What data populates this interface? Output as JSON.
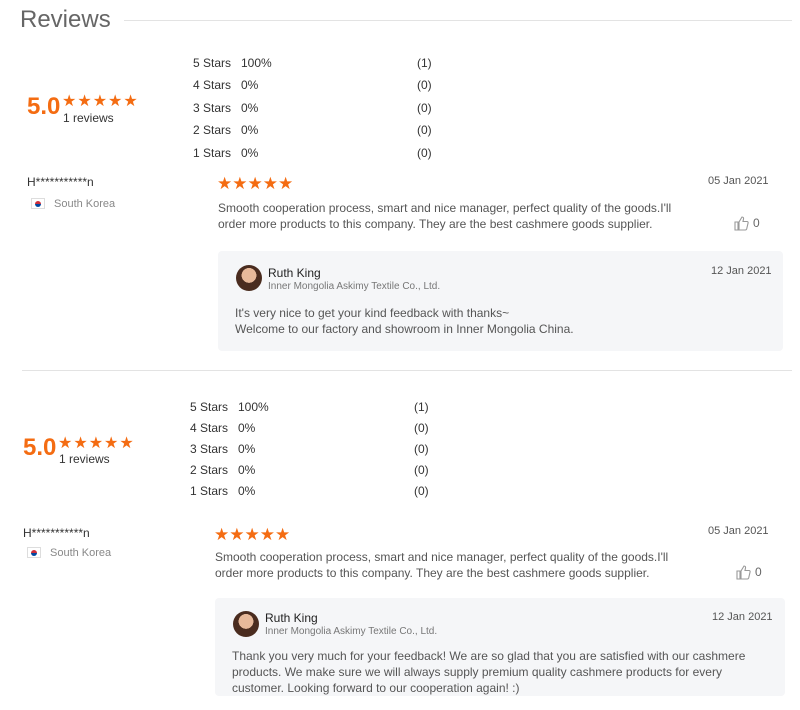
{
  "header": {
    "title": "Reviews"
  },
  "sections": [
    {
      "summary": {
        "score": "5.0",
        "stars": "★★★★★",
        "count_text": "1 reviews"
      },
      "distribution": [
        {
          "label": "5  Stars",
          "percent": "100%",
          "count": "(1)"
        },
        {
          "label": "4  Stars",
          "percent": "0%",
          "count": "(0)"
        },
        {
          "label": "3  Stars",
          "percent": "0%",
          "count": "(0)"
        },
        {
          "label": "2  Stars",
          "percent": "0%",
          "count": "(0)"
        },
        {
          "label": "1  Stars",
          "percent": "0%",
          "count": "(0)"
        }
      ],
      "review": {
        "reviewer": "H***********n",
        "country": "South Korea",
        "stars": "★★★★★",
        "rating": 5,
        "date": "05 Jan 2021",
        "text": "Smooth cooperation process, smart and nice manager, perfect quality of the goods.I'll order more products to this company. They are the best cashmere goods supplier.",
        "likes": "0",
        "reply": {
          "name": "Ruth King",
          "company": "Inner Mongolia Askimy Textile Co., Ltd.",
          "date": "12 Jan 2021",
          "text": "It's very nice to get your kind feedback with thanks~\nWelcome to our factory and showroom in Inner Mongolia China."
        }
      }
    },
    {
      "summary": {
        "score": "5.0",
        "stars": "★★★★★",
        "count_text": "1 reviews"
      },
      "distribution": [
        {
          "label": "5  Stars",
          "percent": "100%",
          "count": "(1)"
        },
        {
          "label": "4  Stars",
          "percent": "0%",
          "count": "(0)"
        },
        {
          "label": "3  Stars",
          "percent": "0%",
          "count": "(0)"
        },
        {
          "label": "2  Stars",
          "percent": "0%",
          "count": "(0)"
        },
        {
          "label": "1  Stars",
          "percent": "0%",
          "count": "(0)"
        }
      ],
      "review": {
        "reviewer": "H***********n",
        "country": "South Korea",
        "stars": "★★★★★",
        "rating": 5,
        "date": "05 Jan 2021",
        "text": "Smooth cooperation process, smart and nice manager, perfect quality of the goods.I'll order more products to this company. They are the best cashmere goods supplier.",
        "likes": "0",
        "reply": {
          "name": "Ruth King",
          "company": "Inner Mongolia Askimy Textile Co., Ltd.",
          "date": "12 Jan 2021",
          "text": "Thank you very much for your feedback! We are so glad that you are satisfied with our cashmere products. We make sure we will always supply premium quality cashmere products for every customer. Looking forward to our cooperation again! :)"
        }
      }
    }
  ],
  "colors": {
    "accent": "#f46c12",
    "reply_bg": "#f5f6f8",
    "divider": "#e3e3e3"
  },
  "icons": {
    "like": "thumbs-up-icon",
    "flag": "south-korea-flag-icon",
    "avatar": "avatar"
  }
}
